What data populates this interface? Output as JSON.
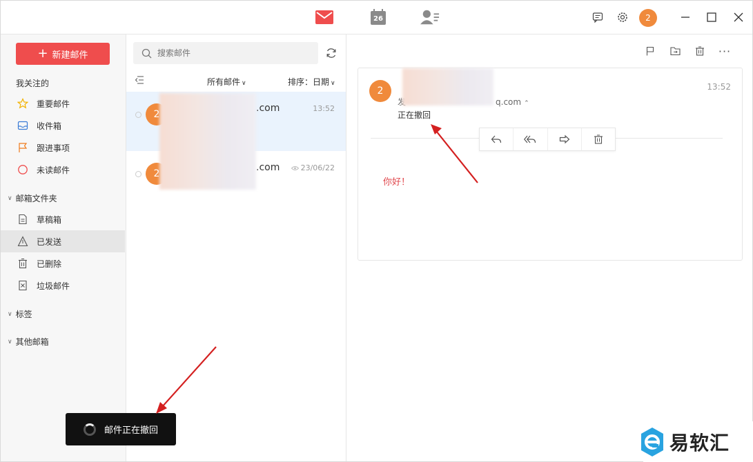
{
  "header": {
    "calendar_day": "26",
    "user_badge": "2"
  },
  "sidebar": {
    "compose_label": "新建邮件",
    "following_title": "我关注的",
    "following_items": [
      "重要邮件",
      "收件箱",
      "跟进事项",
      "未读邮件"
    ],
    "folders_title": "邮箱文件夹",
    "folder_items": [
      "草稿箱",
      "已发送",
      "已删除",
      "垃圾邮件"
    ],
    "active_folder": "已发送",
    "tags_title": "标签",
    "other_title": "其他邮箱"
  },
  "list": {
    "search_placeholder": "搜索邮件",
    "filter_label": "所有邮件",
    "sort_label": "排序：日期",
    "items": [
      {
        "avatar": "2",
        "sender_suffix": ".com",
        "time": "13:52"
      },
      {
        "avatar": "2",
        "sender_suffix": ".com",
        "time": "23/06/22"
      }
    ]
  },
  "reader": {
    "avatar": "2",
    "time": "13:52",
    "from_prefix": "发",
    "from_suffix": "q.com",
    "status": "正在撤回",
    "body": "你好！"
  },
  "toast": {
    "message": "邮件正在撤回"
  },
  "watermark": {
    "text": "易软汇"
  },
  "colors": {
    "accent": "#ef4d4d",
    "avatar": "#f08a3c",
    "selected_row": "#eaf3fd",
    "body_text": "#e0474c"
  }
}
